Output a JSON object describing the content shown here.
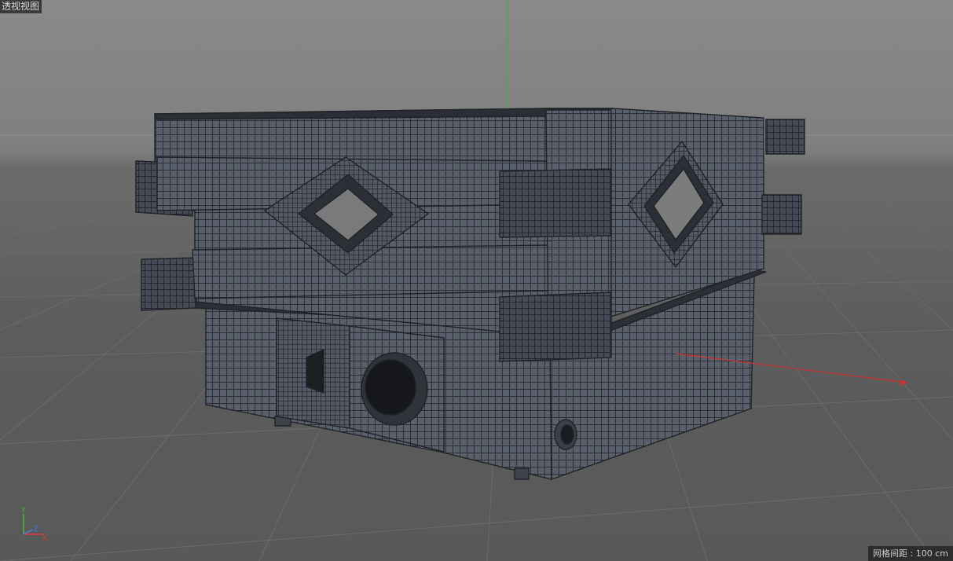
{
  "viewport": {
    "title": "透视视图",
    "grid_spacing": "网格间距 : 100 cm"
  },
  "axis_gizmo": {
    "labels": [
      "Y",
      "Z",
      "X"
    ],
    "colors": {
      "x": "#e03a3a",
      "y": "#3fbf3f",
      "z": "#4a7ce0"
    }
  },
  "scene": {
    "background_color": "#7f7f7f",
    "floor_color": "#5c5c5c",
    "grid_line_color": "#6e6e6e",
    "model_color": "#595f6b",
    "wire_color": "#2a2d33",
    "x_axis_color": "#d23030",
    "y_axis_color": "#3ab53a"
  }
}
